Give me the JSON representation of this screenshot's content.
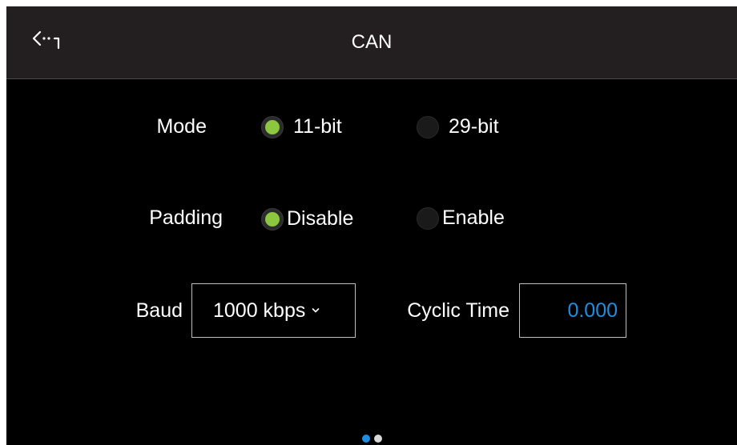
{
  "header": {
    "title": "CAN",
    "back_icon": "back-arrow-icon"
  },
  "mode": {
    "label": "Mode",
    "options": [
      "11-bit",
      "29-bit"
    ],
    "selected": "11-bit"
  },
  "padding": {
    "label": "Padding",
    "options": [
      "Disable",
      "Enable"
    ],
    "selected": "Disable"
  },
  "baud": {
    "label": "Baud",
    "value": "1000 kbps"
  },
  "cyclic": {
    "label": "Cyclic Time",
    "value": "0.000"
  },
  "pager": {
    "count": 2,
    "active_index": 0
  },
  "colors": {
    "header_bg": "#231f20",
    "screen_bg": "#000000",
    "radio_selected": "#8dc63f",
    "accent_blue": "#1e8fe0"
  }
}
